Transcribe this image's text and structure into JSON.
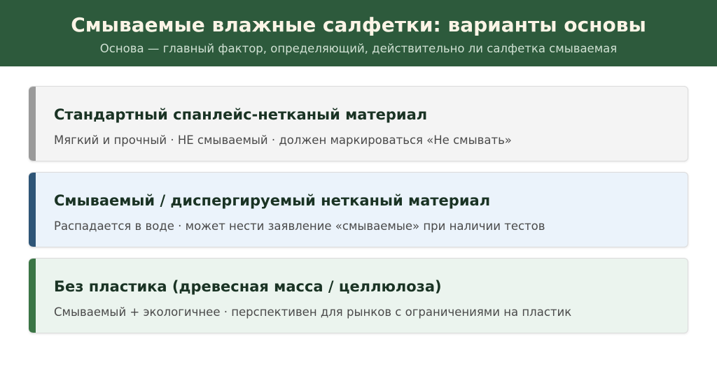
{
  "header": {
    "title": "Смываемые влажные салфетки: варианты основы",
    "subtitle": "Основа — главный фактор, определяющий, действительно ли салфетка смываемая"
  },
  "cards": [
    {
      "title": "Стандартный спанлейс-нетканый материал",
      "description": "Мягкий и прочный · НЕ смываемый · должен маркироваться «Не смывать»",
      "accent_color": "#9a9a9a",
      "background_color": "#f4f4f4"
    },
    {
      "title": "Смываемый / диспергируемый нетканый материал",
      "description": "Распадается в воде · может нести заявление «смываемые» при наличии тестов",
      "accent_color": "#2e5577",
      "background_color": "#ebf3fb"
    },
    {
      "title": "Без пластика (древесная масса / целлюлоза)",
      "description": "Смываемый + экологичнее · перспективен для рынков с ограничениями на пластик",
      "accent_color": "#3a7545",
      "background_color": "#ebf4ee"
    }
  ]
}
